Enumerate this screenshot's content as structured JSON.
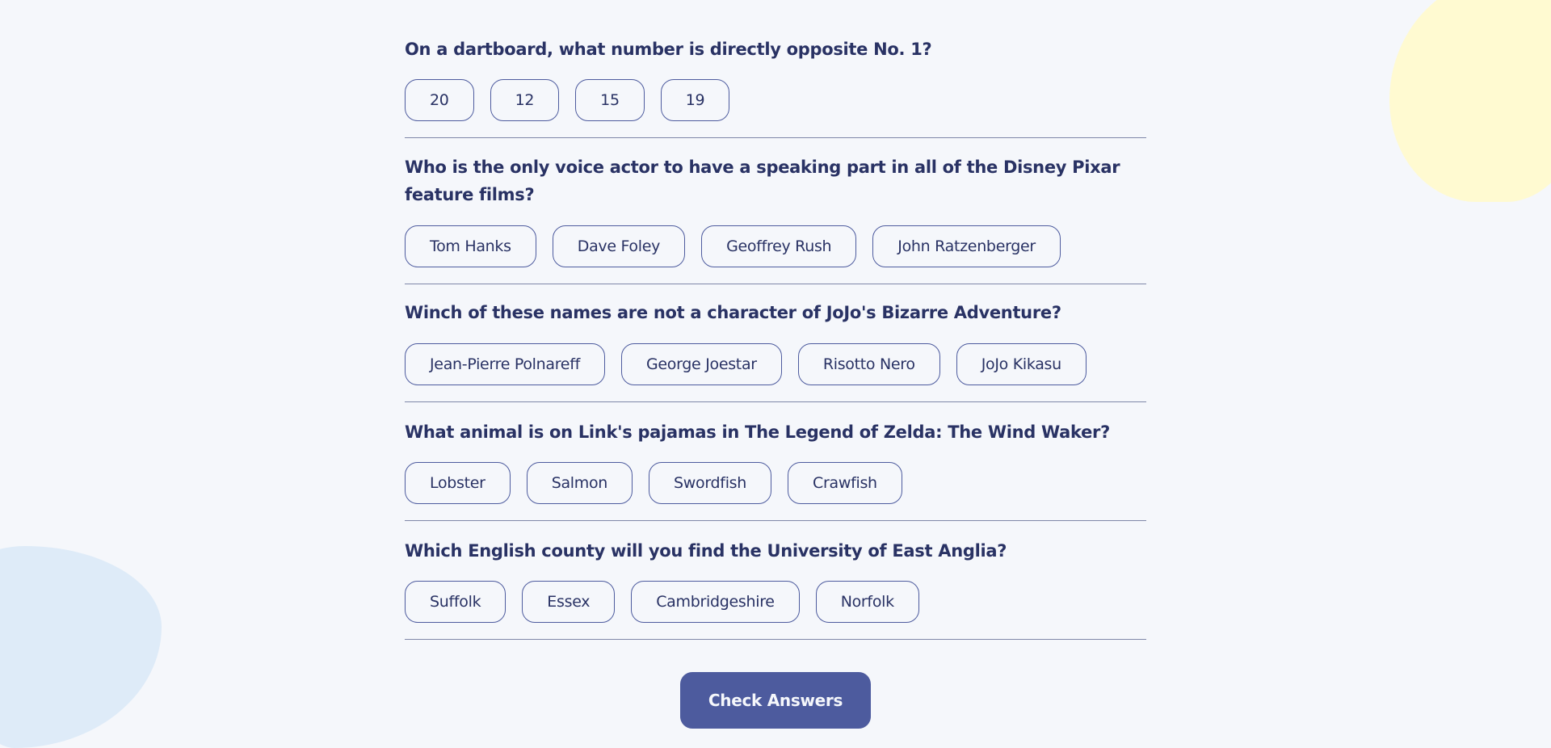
{
  "questions": [
    {
      "text": "On a dartboard, what number is directly opposite No. 1?",
      "answers": [
        "20",
        "12",
        "15",
        "19"
      ]
    },
    {
      "text": "Who is the only voice actor to have a speaking part in all of the Disney Pixar feature films?",
      "answers": [
        "Tom Hanks",
        "Dave Foley",
        "Geoffrey Rush",
        "John Ratzenberger"
      ]
    },
    {
      "text": "Winch of these names are not a character of JoJo's Bizarre Adventure?",
      "answers": [
        "Jean-Pierre Polnareff",
        "George Joestar",
        "Risotto Nero",
        "JoJo Kikasu"
      ]
    },
    {
      "text": "What animal is on Link's pajamas in The Legend of Zelda: The Wind Waker?",
      "answers": [
        "Lobster",
        "Salmon",
        "Swordfish",
        "Crawfish"
      ]
    },
    {
      "text": "Which English county will you find the University of East Anglia?",
      "answers": [
        "Suffolk",
        "Essex",
        "Cambridgeshire",
        "Norfolk"
      ]
    }
  ],
  "check_button_label": "Check Answers",
  "colors": {
    "background": "#f5f7fb",
    "text": "#293264",
    "accent": "#4d5b9e",
    "blob_yellow": "#fffad1",
    "blob_blue": "#deebf8"
  }
}
